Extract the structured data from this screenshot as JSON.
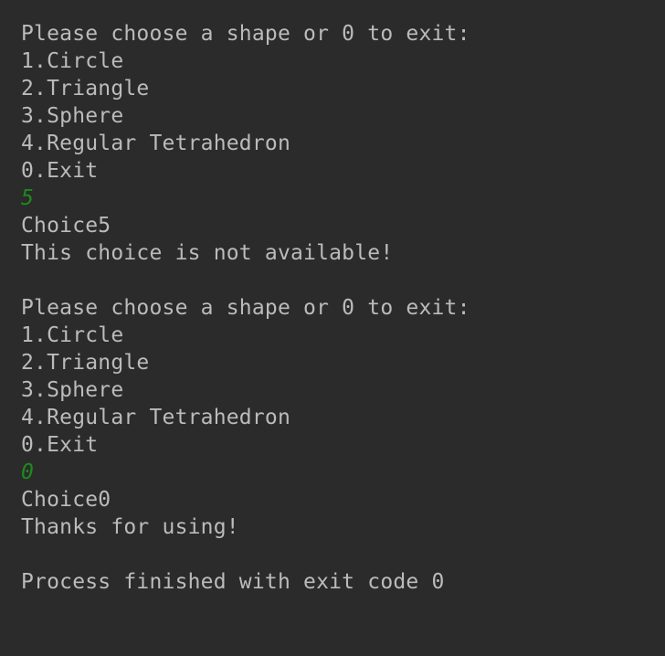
{
  "console": {
    "colors": {
      "background": "#2b2b2b",
      "output_text": "#bbbbbb",
      "user_input": "#1d8a1d"
    },
    "lines": [
      {
        "type": "output",
        "text": "Please choose a shape or 0 to exit:"
      },
      {
        "type": "output",
        "text": "1.Circle"
      },
      {
        "type": "output",
        "text": "2.Triangle"
      },
      {
        "type": "output",
        "text": "3.Sphere"
      },
      {
        "type": "output",
        "text": "4.Regular Tetrahedron"
      },
      {
        "type": "output",
        "text": "0.Exit"
      },
      {
        "type": "input",
        "text": "5"
      },
      {
        "type": "output",
        "text": "Choice5"
      },
      {
        "type": "output",
        "text": "This choice is not available!"
      },
      {
        "type": "output",
        "text": ""
      },
      {
        "type": "output",
        "text": "Please choose a shape or 0 to exit:"
      },
      {
        "type": "output",
        "text": "1.Circle"
      },
      {
        "type": "output",
        "text": "2.Triangle"
      },
      {
        "type": "output",
        "text": "3.Sphere"
      },
      {
        "type": "output",
        "text": "4.Regular Tetrahedron"
      },
      {
        "type": "output",
        "text": "0.Exit"
      },
      {
        "type": "input",
        "text": "0"
      },
      {
        "type": "output",
        "text": "Choice0"
      },
      {
        "type": "output",
        "text": "Thanks for using!"
      },
      {
        "type": "output",
        "text": ""
      },
      {
        "type": "output",
        "text": "Process finished with exit code 0"
      }
    ]
  }
}
